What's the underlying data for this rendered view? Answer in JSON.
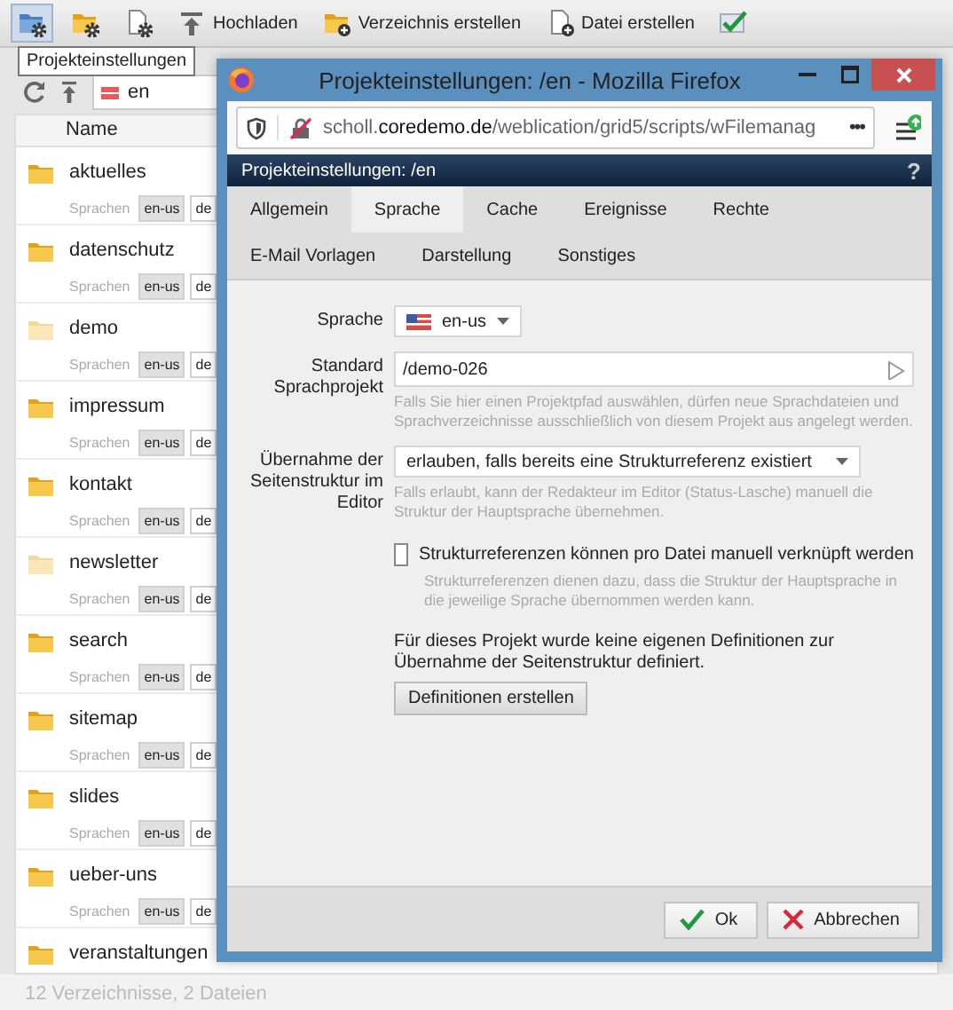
{
  "toolbar": {
    "items": [
      {
        "kind": "icon",
        "selected": true
      },
      {
        "kind": "icon",
        "selected": false
      },
      {
        "kind": "icon",
        "selected": false
      },
      {
        "kind": "labeled",
        "label": "Hochladen",
        "selected": false
      },
      {
        "kind": "labeled",
        "label": "Verzeichnis erstellen",
        "selected": false
      },
      {
        "kind": "labeled",
        "label": "Datei erstellen",
        "selected": false
      },
      {
        "kind": "icon",
        "selected": false
      }
    ],
    "tooltip": "Projekteinstellungen"
  },
  "path_field": {
    "value": "en"
  },
  "file_list": {
    "column": "Name",
    "rows": [
      {
        "name": "aktuelles",
        "dimmed": false,
        "languages_label": "Sprachen",
        "languages": [
          {
            "code": "en-us",
            "selected": true
          },
          {
            "code": "de",
            "selected": false
          }
        ]
      },
      {
        "name": "datenschutz",
        "dimmed": false,
        "languages_label": "Sprachen",
        "languages": [
          {
            "code": "en-us",
            "selected": true
          },
          {
            "code": "de",
            "selected": false
          }
        ]
      },
      {
        "name": "demo",
        "dimmed": true,
        "languages_label": "Sprachen",
        "languages": [
          {
            "code": "en-us",
            "selected": true
          },
          {
            "code": "de",
            "selected": false
          }
        ]
      },
      {
        "name": "impressum",
        "dimmed": false,
        "languages_label": "Sprachen",
        "languages": [
          {
            "code": "en-us",
            "selected": true
          },
          {
            "code": "de",
            "selected": false
          }
        ]
      },
      {
        "name": "kontakt",
        "dimmed": false,
        "languages_label": "Sprachen",
        "languages": [
          {
            "code": "en-us",
            "selected": true
          },
          {
            "code": "de",
            "selected": false
          }
        ]
      },
      {
        "name": "newsletter",
        "dimmed": true,
        "languages_label": "Sprachen",
        "languages": [
          {
            "code": "en-us",
            "selected": true
          },
          {
            "code": "de",
            "selected": false
          }
        ]
      },
      {
        "name": "search",
        "dimmed": false,
        "languages_label": "Sprachen",
        "languages": [
          {
            "code": "en-us",
            "selected": true
          },
          {
            "code": "de",
            "selected": false
          }
        ]
      },
      {
        "name": "sitemap",
        "dimmed": false,
        "languages_label": "Sprachen",
        "languages": [
          {
            "code": "en-us",
            "selected": true
          },
          {
            "code": "de",
            "selected": false
          }
        ]
      },
      {
        "name": "slides",
        "dimmed": false,
        "languages_label": "Sprachen",
        "languages": [
          {
            "code": "en-us",
            "selected": true
          },
          {
            "code": "de",
            "selected": false
          }
        ]
      },
      {
        "name": "ueber-uns",
        "dimmed": false,
        "languages_label": "Sprachen",
        "languages": [
          {
            "code": "en-us",
            "selected": true
          },
          {
            "code": "de",
            "selected": false
          }
        ]
      },
      {
        "name": "veranstaltungen",
        "dimmed": false
      }
    ]
  },
  "status_bar": "12 Verzeichnisse, 2 Dateien",
  "browser_window": {
    "title": "Projekteinstellungen: /en - Mozilla Firefox",
    "url_subdomain": "scholl.",
    "url_domain": "coredemo.de",
    "url_path": "/weblication/grid5/scripts/wFilemanag",
    "more": "•••"
  },
  "dialog": {
    "title": "Projekteinstellungen: /en",
    "help": "?",
    "tabs": [
      [
        {
          "label": "Allgemein",
          "selected": false
        },
        {
          "label": "Sprache",
          "selected": true
        },
        {
          "label": "Cache",
          "selected": false
        },
        {
          "label": "Ereignisse",
          "selected": false
        },
        {
          "label": "Rechte",
          "selected": false
        }
      ],
      [
        {
          "label": "E-Mail Vorlagen",
          "selected": false
        },
        {
          "label": "Darstellung",
          "selected": false
        },
        {
          "label": "Sonstiges",
          "selected": false
        }
      ]
    ],
    "fields": [
      {
        "kind": "language",
        "label": "Sprache",
        "value": "en-us"
      },
      {
        "kind": "path",
        "label": "Standard Sprachprojekt",
        "value": "/demo-026",
        "hint": "Falls Sie hier einen Projektpfad auswählen, dürfen neue Sprachdateien und Sprachverzeichnisse ausschließlich von diesem Projekt aus angelegt werden."
      },
      {
        "kind": "select",
        "label": "Übernahme der Seitenstruktur im Editor",
        "value": "erlauben, falls bereits eine Strukturreferenz existiert",
        "hint": "Falls erlaubt, kann der Redakteur im Editor (Status-Lasche) manuell die Struktur der Hauptsprache übernehmen."
      },
      {
        "kind": "checkbox",
        "label": "Strukturreferenzen können pro Datei manuell verknüpft werden",
        "checked": false,
        "hint": "Strukturreferenzen dienen dazu, dass die Struktur der Hauptsprache in die jeweilige Sprache übernommen werden kann."
      },
      {
        "kind": "note",
        "text": "Für dieses Projekt wurde keine eigenen Definitionen zur Übernahme der Seitenstruktur definiert."
      },
      {
        "kind": "button",
        "label": "Definitionen erstellen"
      }
    ],
    "buttons": [
      {
        "kind": "ok",
        "label": "Ok"
      },
      {
        "kind": "cancel",
        "label": "Abbrechen"
      }
    ]
  }
}
